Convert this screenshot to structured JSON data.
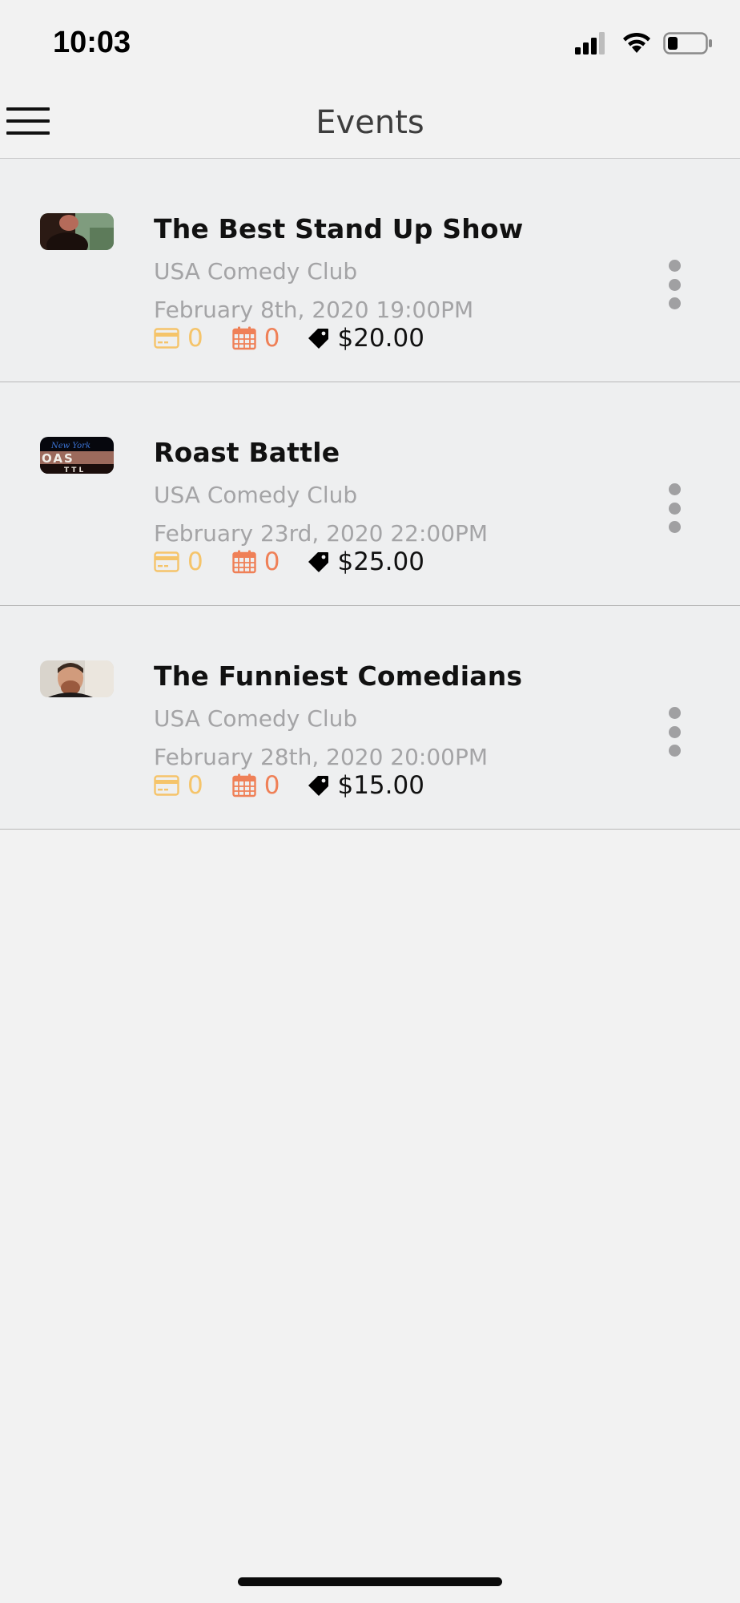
{
  "status_bar": {
    "time": "10:03",
    "icons": [
      "signal-icon",
      "wifi-icon",
      "battery-icon"
    ]
  },
  "nav": {
    "title": "Events",
    "menu_icon": "hamburger-menu-icon"
  },
  "events": [
    {
      "title": "The Best Stand Up Show",
      "venue": "USA Comedy Club",
      "date": "February 8th, 2020 19:00PM",
      "card_count": "0",
      "calendar_count": "0",
      "price": "$20.00",
      "thumbnail": "comedian-photo"
    },
    {
      "title": "Roast Battle",
      "venue": "USA Comedy Club",
      "date": "February 23rd, 2020 22:00PM",
      "card_count": "0",
      "calendar_count": "0",
      "price": "$25.00",
      "thumbnail": "roast-battle-logo",
      "thumbnail_text": "New York"
    },
    {
      "title": "The Funniest Comedians",
      "venue": "USA Comedy Club",
      "date": "February 28th, 2020 20:00PM",
      "card_count": "0",
      "calendar_count": "0",
      "price": "$15.00",
      "thumbnail": "comedian-portrait"
    }
  ],
  "colors": {
    "card_accent": "#f5c46a",
    "calendar_accent": "#ef8057",
    "secondary_text": "#a4a4a6",
    "row_background": "#eeeff0",
    "page_background": "#f2f2f2"
  }
}
